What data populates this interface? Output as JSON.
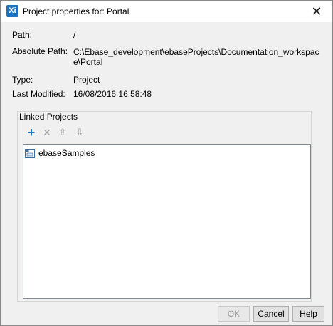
{
  "window": {
    "app_icon": "Xi",
    "title": "Project properties for: Portal",
    "close_glyph": "✕"
  },
  "properties": {
    "path_label": "Path:",
    "path_value": "/",
    "absolute_path_label": "Absolute Path:",
    "absolute_path_value": "C:\\Ebase_development\\ebaseProjects\\Documentation_workspace\\Portal",
    "type_label": "Type:",
    "type_value": "Project",
    "last_modified_label": "Last Modified:",
    "last_modified_value": "16/08/2016 16:58:48"
  },
  "linked_projects": {
    "title": "Linked Projects",
    "toolbar": {
      "add_glyph": "+",
      "remove_glyph": "✕",
      "up_glyph": "⇧",
      "down_glyph": "⇩"
    },
    "items": [
      {
        "label": "ebaseSamples",
        "icon": "project-folder-icon"
      }
    ]
  },
  "buttons": {
    "ok": "OK",
    "cancel": "Cancel",
    "help": "Help"
  },
  "colors": {
    "accent": "#1e73be",
    "disabled": "#a0a0a0",
    "dialog_bg": "#f0f0f0"
  }
}
